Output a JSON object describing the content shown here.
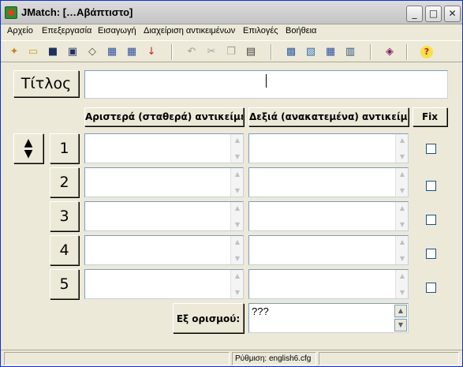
{
  "window": {
    "title": "JMatch: […Αβάπτιστο]"
  },
  "menu": [
    "Αρχείο",
    "Επεξεργασία",
    "Εισαγωγή",
    "Διαχείριση αντικειμένων",
    "Επιλογές",
    "Βοήθεια"
  ],
  "title_label": "Τίτλος",
  "title_value": "",
  "columns": {
    "left": "Αριστερά (σταθερά) αντικείμενα",
    "right": "Δεξιά (ανακατεμένα) αντικείμενα",
    "fix": "Fix"
  },
  "rows": [
    {
      "num": "1",
      "left": "",
      "right": "",
      "fixed": false
    },
    {
      "num": "2",
      "left": "",
      "right": "",
      "fixed": false
    },
    {
      "num": "3",
      "left": "",
      "right": "",
      "fixed": false
    },
    {
      "num": "4",
      "left": "",
      "right": "",
      "fixed": false
    },
    {
      "num": "5",
      "left": "",
      "right": "",
      "fixed": false
    }
  ],
  "default_label": "Εξ ορισμού:",
  "default_value": "???",
  "status": {
    "config": "Ρύθμιση: english6.cfg"
  }
}
